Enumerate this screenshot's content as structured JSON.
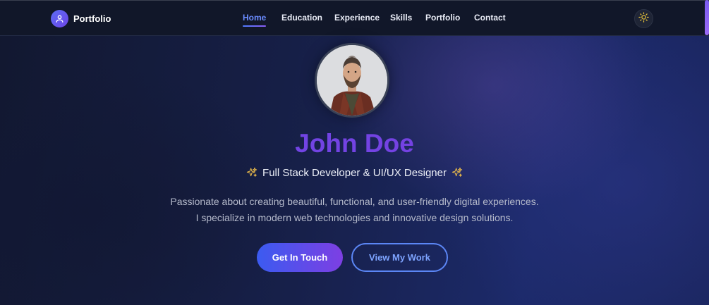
{
  "brand": {
    "name": "Portfolio",
    "icon": "user-icon"
  },
  "nav": {
    "items": [
      {
        "label": "Home",
        "active": true
      },
      {
        "label": "Education",
        "active": false
      },
      {
        "label": "Experience",
        "active": false
      },
      {
        "label": "Skills",
        "active": false
      },
      {
        "label": "Portfolio",
        "active": false
      },
      {
        "label": "Contact",
        "active": false
      }
    ],
    "theme_toggle_icon": "sun-icon"
  },
  "hero": {
    "name": "John Doe",
    "role": "Full Stack Developer & UI/UX Designer",
    "role_icon": "sparkles-icon",
    "description_line1": "Passionate about creating beautiful, functional, and user-friendly digital experiences.",
    "description_line2": "I specialize in modern web technologies and innovative design solutions.",
    "primary_button": "Get In Touch",
    "secondary_button": "View My Work"
  },
  "colors": {
    "accent": "#6b8cff",
    "name_gradient_start": "#6c47e6",
    "name_gradient_end": "#7a3fe0",
    "sparkle": "#e7b84a",
    "sun": "#e6c23a"
  }
}
